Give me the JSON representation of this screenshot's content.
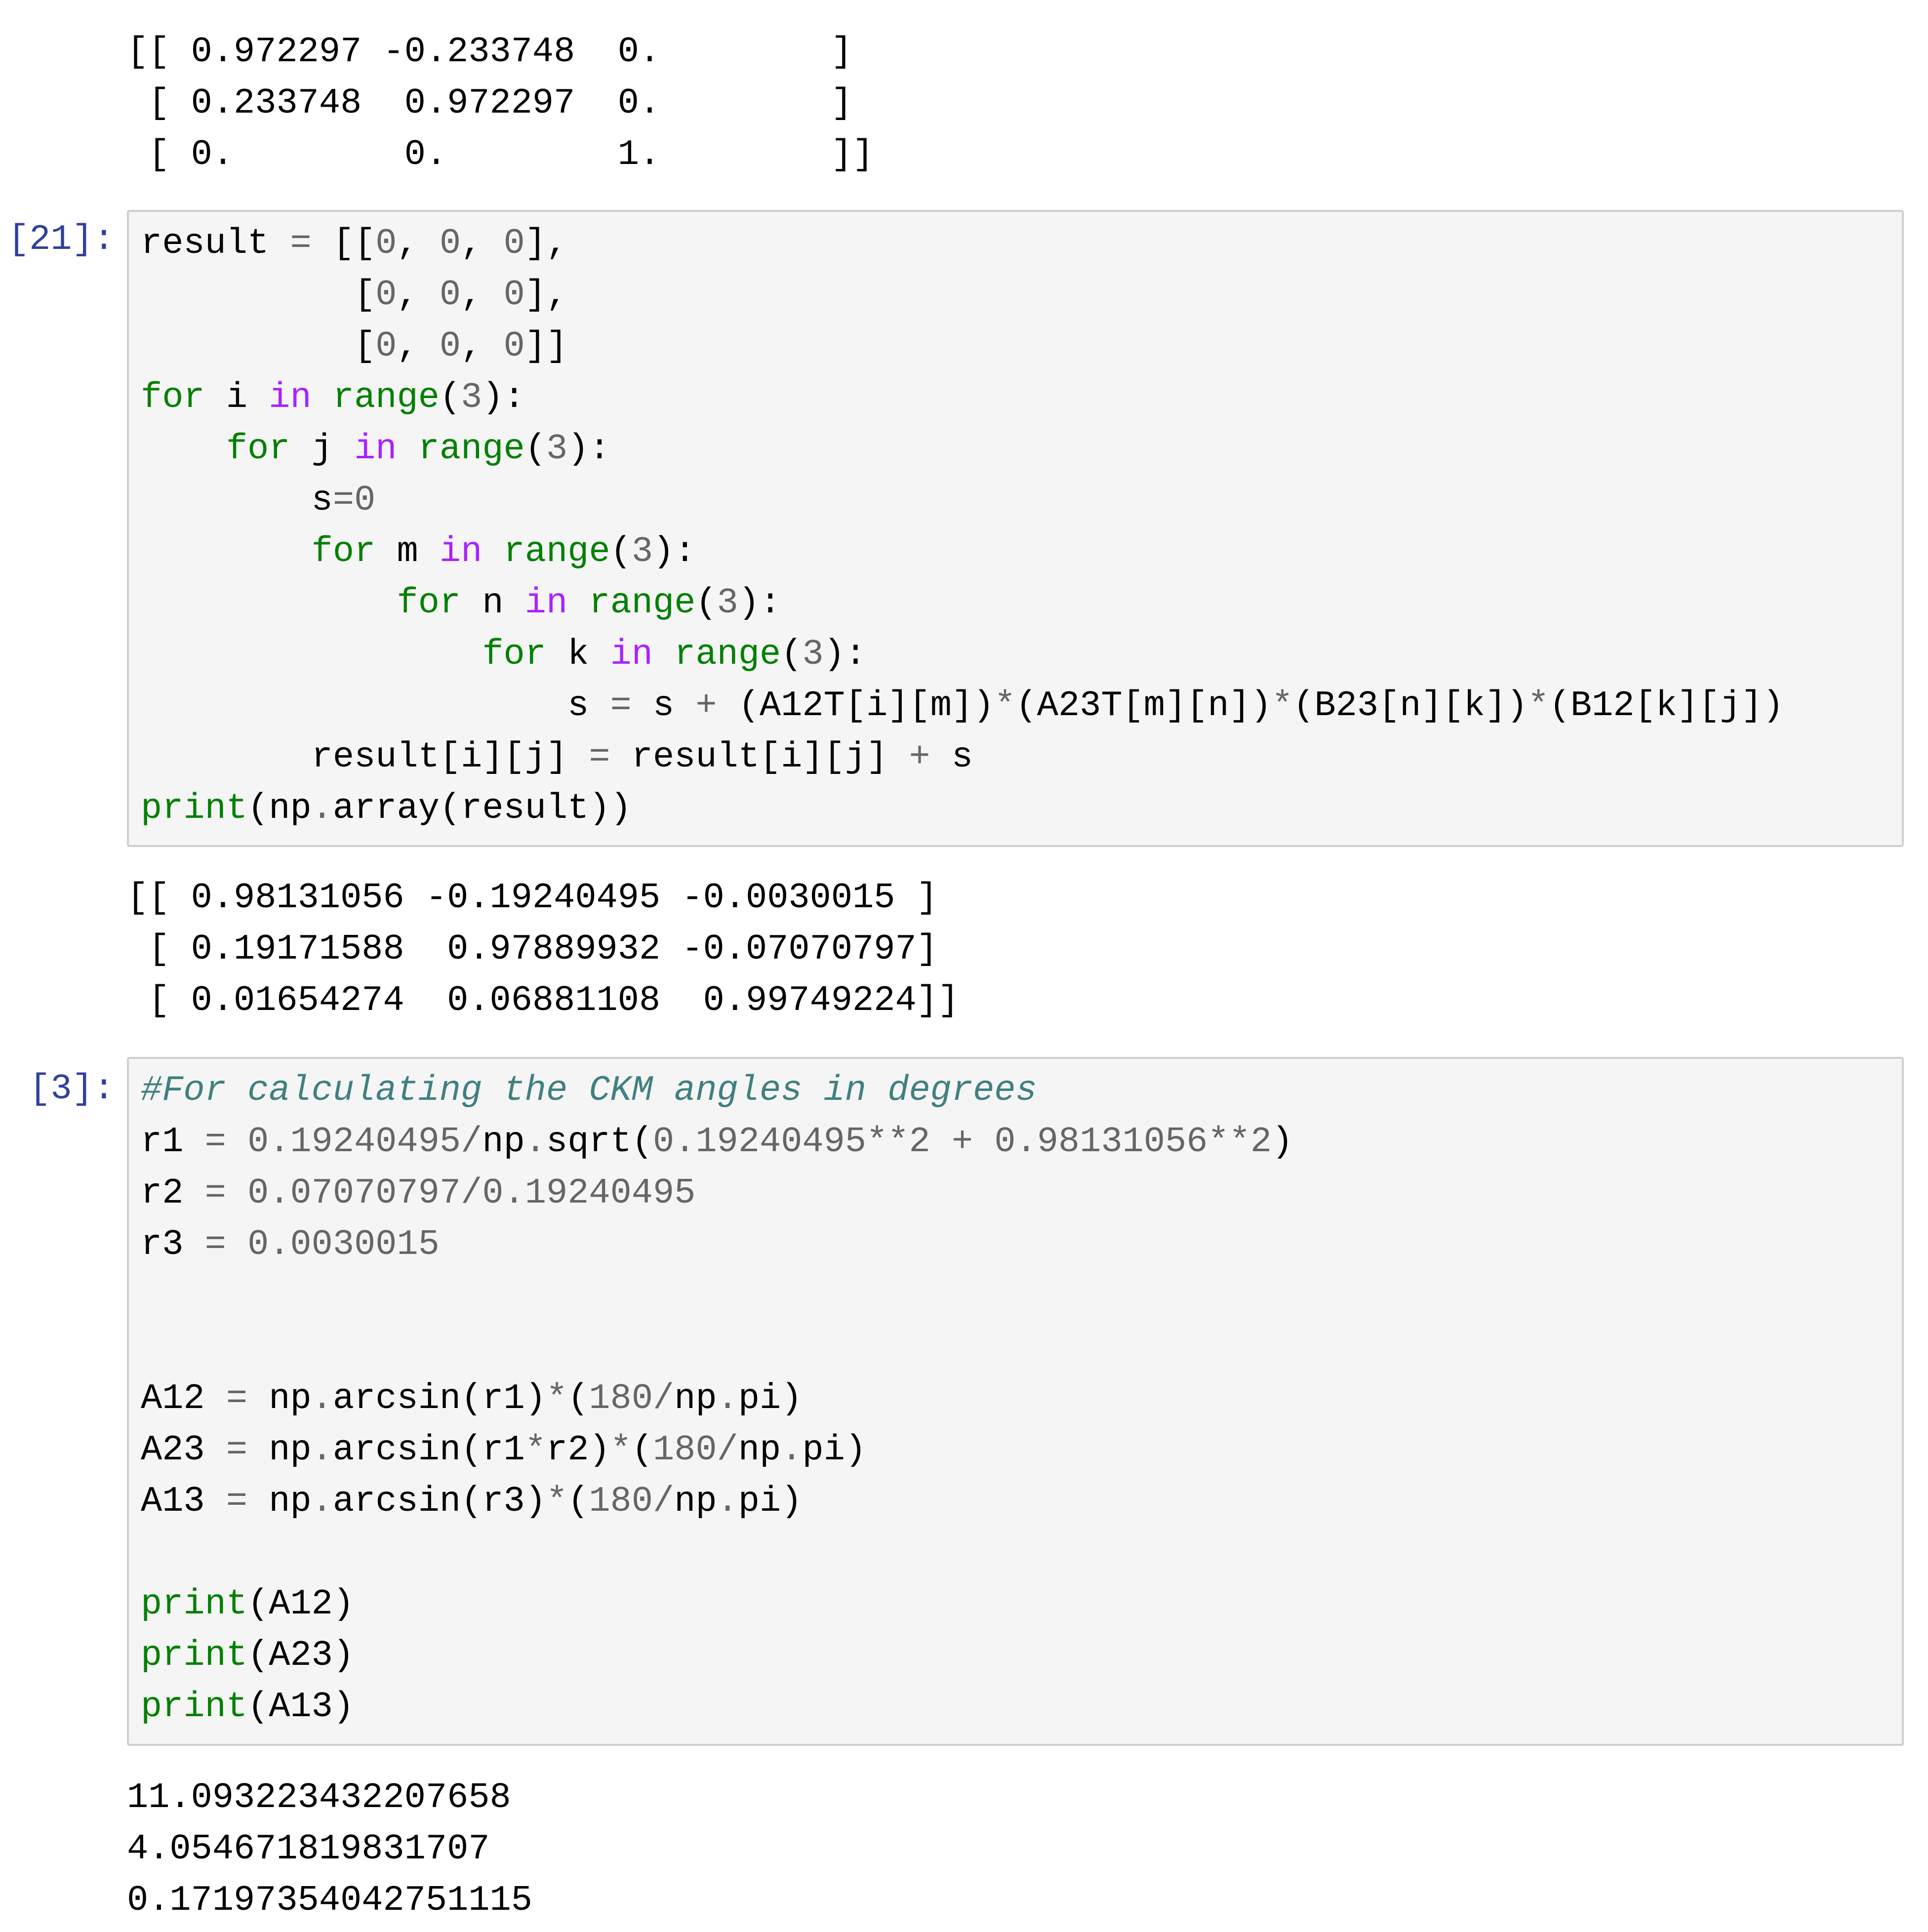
{
  "output_prev": {
    "lines": [
      "[[ 0.972297 -0.233748  0.        ]",
      " [ 0.233748  0.972297  0.        ]",
      " [ 0.        0.        1.        ]]"
    ]
  },
  "cell21": {
    "prompt": "[21]:",
    "code": [
      [
        {
          "t": "result "
        },
        {
          "t": "=",
          "c": "o"
        },
        {
          "t": " [["
        },
        {
          "t": "0",
          "c": "n"
        },
        {
          "t": ", "
        },
        {
          "t": "0",
          "c": "n"
        },
        {
          "t": ", "
        },
        {
          "t": "0",
          "c": "n"
        },
        {
          "t": "],"
        }
      ],
      [
        {
          "t": "          ["
        },
        {
          "t": "0",
          "c": "n"
        },
        {
          "t": ", "
        },
        {
          "t": "0",
          "c": "n"
        },
        {
          "t": ", "
        },
        {
          "t": "0",
          "c": "n"
        },
        {
          "t": "],"
        }
      ],
      [
        {
          "t": "          ["
        },
        {
          "t": "0",
          "c": "n"
        },
        {
          "t": ", "
        },
        {
          "t": "0",
          "c": "n"
        },
        {
          "t": ", "
        },
        {
          "t": "0",
          "c": "n"
        },
        {
          "t": "]]"
        }
      ],
      [
        {
          "t": "for",
          "c": "k"
        },
        {
          "t": " i "
        },
        {
          "t": "in",
          "c": "kw"
        },
        {
          "t": " "
        },
        {
          "t": "range",
          "c": "k"
        },
        {
          "t": "("
        },
        {
          "t": "3",
          "c": "n"
        },
        {
          "t": "):"
        }
      ],
      [
        {
          "t": "    "
        },
        {
          "t": "for",
          "c": "k"
        },
        {
          "t": " j "
        },
        {
          "t": "in",
          "c": "kw"
        },
        {
          "t": " "
        },
        {
          "t": "range",
          "c": "k"
        },
        {
          "t": "("
        },
        {
          "t": "3",
          "c": "n"
        },
        {
          "t": "):"
        }
      ],
      [
        {
          "t": "        s"
        },
        {
          "t": "=",
          "c": "o"
        },
        {
          "t": "0",
          "c": "n"
        }
      ],
      [
        {
          "t": "        "
        },
        {
          "t": "for",
          "c": "k"
        },
        {
          "t": " m "
        },
        {
          "t": "in",
          "c": "kw"
        },
        {
          "t": " "
        },
        {
          "t": "range",
          "c": "k"
        },
        {
          "t": "("
        },
        {
          "t": "3",
          "c": "n"
        },
        {
          "t": "):"
        }
      ],
      [
        {
          "t": "            "
        },
        {
          "t": "for",
          "c": "k"
        },
        {
          "t": " n "
        },
        {
          "t": "in",
          "c": "kw"
        },
        {
          "t": " "
        },
        {
          "t": "range",
          "c": "k"
        },
        {
          "t": "("
        },
        {
          "t": "3",
          "c": "n"
        },
        {
          "t": "):"
        }
      ],
      [
        {
          "t": "                "
        },
        {
          "t": "for",
          "c": "k"
        },
        {
          "t": " k "
        },
        {
          "t": "in",
          "c": "kw"
        },
        {
          "t": " "
        },
        {
          "t": "range",
          "c": "k"
        },
        {
          "t": "("
        },
        {
          "t": "3",
          "c": "n"
        },
        {
          "t": "):"
        }
      ],
      [
        {
          "t": "                    s "
        },
        {
          "t": "=",
          "c": "o"
        },
        {
          "t": " s "
        },
        {
          "t": "+",
          "c": "o"
        },
        {
          "t": " (A12T[i][m])"
        },
        {
          "t": "*",
          "c": "o"
        },
        {
          "t": "(A23T[m][n])"
        },
        {
          "t": "*",
          "c": "o"
        },
        {
          "t": "(B23[n][k])"
        },
        {
          "t": "*",
          "c": "o"
        },
        {
          "t": "(B12[k][j])"
        }
      ],
      [
        {
          "t": "        result[i][j] "
        },
        {
          "t": "=",
          "c": "o"
        },
        {
          "t": " result[i][j] "
        },
        {
          "t": "+",
          "c": "o"
        },
        {
          "t": " s"
        }
      ],
      [
        {
          "t": "print",
          "c": "k"
        },
        {
          "t": "(np"
        },
        {
          "t": ".",
          "c": "o"
        },
        {
          "t": "array(result))"
        }
      ]
    ]
  },
  "output21": {
    "lines": [
      "[[ 0.98131056 -0.19240495 -0.0030015 ]",
      " [ 0.19171588  0.97889932 -0.07070797]",
      " [ 0.01654274  0.06881108  0.99749224]]"
    ]
  },
  "cell3": {
    "prompt": "[3]:",
    "code": [
      [
        {
          "t": "#For calculating the CKM angles in degrees",
          "c": "c"
        }
      ],
      [
        {
          "t": "r1 "
        },
        {
          "t": "=",
          "c": "o"
        },
        {
          "t": " "
        },
        {
          "t": "0.19240495",
          "c": "n"
        },
        {
          "t": "/",
          "c": "o"
        },
        {
          "t": "np"
        },
        {
          "t": ".",
          "c": "o"
        },
        {
          "t": "sqrt("
        },
        {
          "t": "0.19240495",
          "c": "n"
        },
        {
          "t": "**",
          "c": "o"
        },
        {
          "t": "2",
          "c": "n"
        },
        {
          "t": " "
        },
        {
          "t": "+",
          "c": "o"
        },
        {
          "t": " "
        },
        {
          "t": "0.98131056",
          "c": "n"
        },
        {
          "t": "**",
          "c": "o"
        },
        {
          "t": "2",
          "c": "n"
        },
        {
          "t": ")"
        }
      ],
      [
        {
          "t": "r2 "
        },
        {
          "t": "=",
          "c": "o"
        },
        {
          "t": " "
        },
        {
          "t": "0.07070797",
          "c": "n"
        },
        {
          "t": "/",
          "c": "o"
        },
        {
          "t": "0.19240495",
          "c": "n"
        }
      ],
      [
        {
          "t": "r3 "
        },
        {
          "t": "=",
          "c": "o"
        },
        {
          "t": " "
        },
        {
          "t": "0.0030015",
          "c": "n"
        }
      ],
      [],
      [],
      [
        {
          "t": "A12 "
        },
        {
          "t": "=",
          "c": "o"
        },
        {
          "t": " np"
        },
        {
          "t": ".",
          "c": "o"
        },
        {
          "t": "arcsin(r1)"
        },
        {
          "t": "*",
          "c": "o"
        },
        {
          "t": "("
        },
        {
          "t": "180",
          "c": "n"
        },
        {
          "t": "/",
          "c": "o"
        },
        {
          "t": "np"
        },
        {
          "t": ".",
          "c": "o"
        },
        {
          "t": "pi)"
        }
      ],
      [
        {
          "t": "A23 "
        },
        {
          "t": "=",
          "c": "o"
        },
        {
          "t": " np"
        },
        {
          "t": ".",
          "c": "o"
        },
        {
          "t": "arcsin(r1"
        },
        {
          "t": "*",
          "c": "o"
        },
        {
          "t": "r2)"
        },
        {
          "t": "*",
          "c": "o"
        },
        {
          "t": "("
        },
        {
          "t": "180",
          "c": "n"
        },
        {
          "t": "/",
          "c": "o"
        },
        {
          "t": "np"
        },
        {
          "t": ".",
          "c": "o"
        },
        {
          "t": "pi)"
        }
      ],
      [
        {
          "t": "A13 "
        },
        {
          "t": "=",
          "c": "o"
        },
        {
          "t": " np"
        },
        {
          "t": ".",
          "c": "o"
        },
        {
          "t": "arcsin(r3)"
        },
        {
          "t": "*",
          "c": "o"
        },
        {
          "t": "("
        },
        {
          "t": "180",
          "c": "n"
        },
        {
          "t": "/",
          "c": "o"
        },
        {
          "t": "np"
        },
        {
          "t": ".",
          "c": "o"
        },
        {
          "t": "pi)"
        }
      ],
      [],
      [
        {
          "t": "print",
          "c": "k"
        },
        {
          "t": "(A12)"
        }
      ],
      [
        {
          "t": "print",
          "c": "k"
        },
        {
          "t": "(A23)"
        }
      ],
      [
        {
          "t": "print",
          "c": "k"
        },
        {
          "t": "(A13)"
        }
      ]
    ]
  },
  "output3": {
    "lines": [
      "11.093223432207658",
      "4.054671819831707",
      "0.17197354042751115"
    ]
  },
  "colors": {
    "prompt": "#303F9F",
    "builtin_keyword": "#008000",
    "operator_keyword": "#AA22FF",
    "number": "#666666",
    "comment": "#408080",
    "cell_background": "#f5f5f5"
  }
}
